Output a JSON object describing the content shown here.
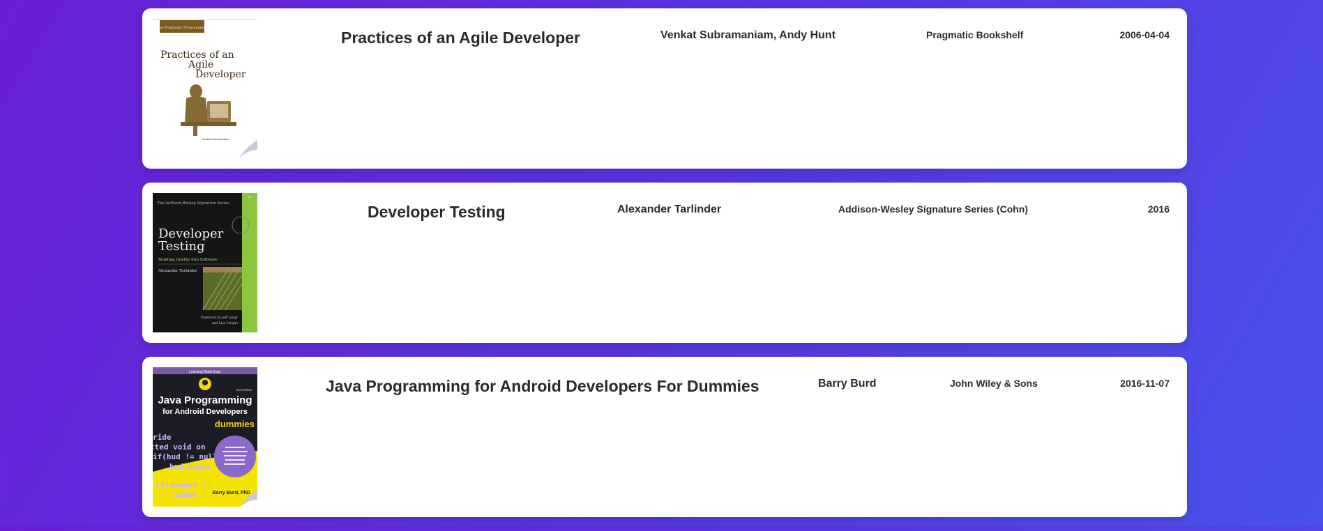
{
  "books": [
    {
      "title": "Practices of an Agile Developer",
      "author": "Venkat Subramaniam, Andy Hunt",
      "publisher": "Pragmatic Bookshelf",
      "date": "2006-04-04",
      "cover": {
        "icon": "book-cover-image",
        "badge": "The Pragmatic Programmers",
        "lines": [
          "Practices of an",
          "Agile",
          "Developer"
        ],
        "byline": "Venkat Subramaniam"
      }
    },
    {
      "title": "Developer Testing",
      "author": "Alexander Tarlinder",
      "publisher": "Addison-Wesley Signature Series (Cohn)",
      "date": "2016",
      "cover": {
        "icon": "book-cover-image",
        "series": "The Addison-Wesley Signature Series",
        "lines": [
          "Developer",
          "Testing"
        ],
        "subtitle": "Building Quality into Software",
        "byline": "Alexander Tarlinder",
        "foreword_1": "Foreword by Jeff Langr",
        "foreword_2": "and Lisa Crispin"
      }
    },
    {
      "title": "Java Programming for Android Developers For Dummies",
      "author": "Barry Burd",
      "publisher": "John Wiley & Sons",
      "date": "2016-11-07",
      "cover": {
        "icon": "book-cover-image",
        "top": "Learning Made Easy",
        "edition": "2nd Edition",
        "lines": [
          "Java Programming",
          "for Android Developers"
        ],
        "brand": "dummies",
        "code": [
          "ride",
          "cted void on",
          "if(hud != null",
          "hud.dismi",
          "if(images !=",
          "image"
        ],
        "byline": "Barry Burd, PhD"
      }
    }
  ]
}
